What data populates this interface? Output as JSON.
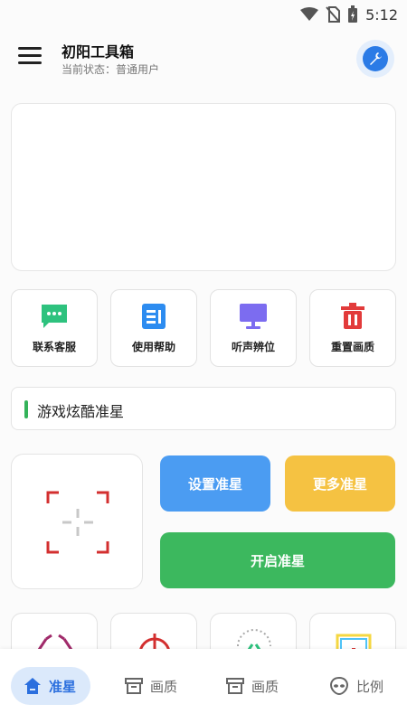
{
  "status_bar": {
    "time": "5:12"
  },
  "header": {
    "title": "初阳工具箱",
    "subtitle": "当前状态：普通用户"
  },
  "quick_actions": [
    {
      "label": "联系客服"
    },
    {
      "label": "使用帮助"
    },
    {
      "label": "听声辨位"
    },
    {
      "label": "重置画质"
    }
  ],
  "section": {
    "title": "游戏炫酷准星"
  },
  "buttons": {
    "set": "设置准星",
    "more": "更多准星",
    "open": "开启准星"
  },
  "bottom_nav": [
    {
      "label": "准星",
      "icon": "home-icon"
    },
    {
      "label": "画质",
      "icon": "archive-icon"
    },
    {
      "label": "画质",
      "icon": "archive-icon"
    },
    {
      "label": "比例",
      "icon": "alien-icon"
    }
  ],
  "colors": {
    "accent": "#2b7be6",
    "green": "#3cb85e",
    "blue": "#4b9cf2",
    "yellow": "#f5c242",
    "red": "#e23b3b"
  }
}
